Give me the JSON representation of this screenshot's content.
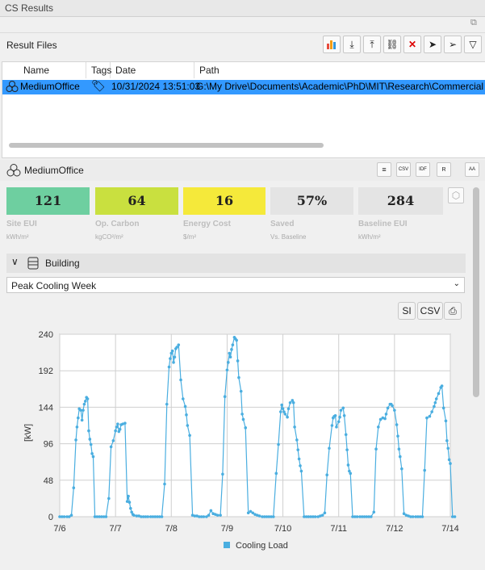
{
  "window": {
    "title": "CS Results"
  },
  "result_files": {
    "label": "Result Files"
  },
  "table": {
    "headers": [
      "Name",
      "Tags",
      "Date",
      "Path"
    ],
    "rows": [
      {
        "name": "MediumOffice",
        "date": "10/31/2024 13:51:03",
        "path": "G:\\My Drive\\Documents\\Academic\\PhD\\MIT\\Research\\Commercial"
      }
    ]
  },
  "detail": {
    "name": "MediumOffice"
  },
  "kpis": [
    {
      "value": "121",
      "label": "Site EUI",
      "unit": "kWh/m²",
      "color": "#6ecfa0"
    },
    {
      "value": "64",
      "label": "Op. Carbon",
      "unit": "kgCO²/m²",
      "color": "#c9e03f"
    },
    {
      "value": "16",
      "label": "Energy Cost",
      "unit": "$/m²",
      "color": "#f5e93a"
    },
    {
      "value": "57%",
      "label": "Saved",
      "unit": "Vs. Baseline",
      "color": "#e4e4e4"
    },
    {
      "value": "284",
      "label": "Baseline EUI",
      "unit": "kWh/m²",
      "color": "#e4e4e4"
    }
  ],
  "section": {
    "label": "Building"
  },
  "dropdown": {
    "selected": "Peak Cooling Week"
  },
  "buttons": {
    "si": "SI",
    "csv": "CSV"
  },
  "chart_data": {
    "type": "line",
    "ylabel": "[kW]",
    "ylim": [
      0,
      240
    ],
    "yticks": [
      "0",
      "48",
      "96",
      "144",
      "192",
      "240"
    ],
    "xticks": [
      "7/6",
      "7/7",
      "7/8",
      "7/9",
      "7/10",
      "7/11",
      "7/12",
      "7/14"
    ],
    "xlim": [
      0,
      7
    ],
    "color": "#4aaee0",
    "series": [
      {
        "name": "Cooling Load",
        "points": [
          [
            0.0,
            0
          ],
          [
            0.04,
            0
          ],
          [
            0.08,
            0
          ],
          [
            0.13,
            0
          ],
          [
            0.17,
            0
          ],
          [
            0.21,
            2
          ],
          [
            0.25,
            38
          ],
          [
            0.29,
            101
          ],
          [
            0.31,
            118
          ],
          [
            0.33,
            130
          ],
          [
            0.35,
            142
          ],
          [
            0.38,
            140
          ],
          [
            0.4,
            127
          ],
          [
            0.42,
            140
          ],
          [
            0.44,
            148
          ],
          [
            0.46,
            152
          ],
          [
            0.48,
            157
          ],
          [
            0.5,
            155
          ],
          [
            0.52,
            113
          ],
          [
            0.54,
            102
          ],
          [
            0.56,
            95
          ],
          [
            0.58,
            83
          ],
          [
            0.6,
            79
          ],
          [
            0.63,
            0
          ],
          [
            0.67,
            0
          ],
          [
            0.71,
            0
          ],
          [
            0.75,
            0
          ],
          [
            0.79,
            0
          ],
          [
            0.83,
            0
          ],
          [
            0.88,
            24
          ],
          [
            0.92,
            92
          ],
          [
            0.96,
            100
          ],
          [
            1.0,
            113
          ],
          [
            1.02,
            118
          ],
          [
            1.04,
            122
          ],
          [
            1.06,
            112
          ],
          [
            1.08,
            115
          ],
          [
            1.1,
            121
          ],
          [
            1.13,
            122
          ],
          [
            1.17,
            123
          ],
          [
            1.21,
            20
          ],
          [
            1.23,
            27
          ],
          [
            1.25,
            19
          ],
          [
            1.27,
            11
          ],
          [
            1.29,
            6
          ],
          [
            1.31,
            3
          ],
          [
            1.33,
            2
          ],
          [
            1.38,
            1
          ],
          [
            1.42,
            1
          ],
          [
            1.46,
            0
          ],
          [
            1.5,
            0
          ],
          [
            1.54,
            0
          ],
          [
            1.58,
            0
          ],
          [
            1.63,
            0
          ],
          [
            1.67,
            0
          ],
          [
            1.71,
            0
          ],
          [
            1.75,
            0
          ],
          [
            1.79,
            0
          ],
          [
            1.83,
            0
          ],
          [
            1.88,
            43
          ],
          [
            1.92,
            148
          ],
          [
            1.96,
            197
          ],
          [
            1.98,
            208
          ],
          [
            2.0,
            215
          ],
          [
            2.02,
            218
          ],
          [
            2.04,
            203
          ],
          [
            2.06,
            210
          ],
          [
            2.08,
            221
          ],
          [
            2.1,
            223
          ],
          [
            2.13,
            226
          ],
          [
            2.17,
            180
          ],
          [
            2.21,
            155
          ],
          [
            2.25,
            145
          ],
          [
            2.27,
            134
          ],
          [
            2.29,
            120
          ],
          [
            2.33,
            107
          ],
          [
            2.38,
            2
          ],
          [
            2.42,
            1
          ],
          [
            2.46,
            1
          ],
          [
            2.5,
            0
          ],
          [
            2.54,
            0
          ],
          [
            2.58,
            0
          ],
          [
            2.63,
            0
          ],
          [
            2.67,
            2
          ],
          [
            2.71,
            8
          ],
          [
            2.75,
            4
          ],
          [
            2.79,
            3
          ],
          [
            2.83,
            2
          ],
          [
            2.88,
            2
          ],
          [
            2.92,
            56
          ],
          [
            2.96,
            158
          ],
          [
            3.0,
            193
          ],
          [
            3.02,
            203
          ],
          [
            3.04,
            215
          ],
          [
            3.06,
            210
          ],
          [
            3.08,
            220
          ],
          [
            3.1,
            226
          ],
          [
            3.13,
            236
          ],
          [
            3.15,
            234
          ],
          [
            3.17,
            232
          ],
          [
            3.19,
            205
          ],
          [
            3.21,
            183
          ],
          [
            3.25,
            165
          ],
          [
            3.27,
            135
          ],
          [
            3.29,
            128
          ],
          [
            3.33,
            117
          ],
          [
            3.38,
            5
          ],
          [
            3.42,
            7
          ],
          [
            3.46,
            5
          ],
          [
            3.5,
            3
          ],
          [
            3.54,
            2
          ],
          [
            3.58,
            1
          ],
          [
            3.63,
            0
          ],
          [
            3.67,
            0
          ],
          [
            3.71,
            0
          ],
          [
            3.75,
            0
          ],
          [
            3.79,
            0
          ],
          [
            3.83,
            0
          ],
          [
            3.88,
            57
          ],
          [
            3.92,
            95
          ],
          [
            3.96,
            138
          ],
          [
            3.98,
            147
          ],
          [
            4.0,
            142
          ],
          [
            4.02,
            138
          ],
          [
            4.04,
            135
          ],
          [
            4.08,
            131
          ],
          [
            4.1,
            142
          ],
          [
            4.13,
            150
          ],
          [
            4.17,
            153
          ],
          [
            4.19,
            150
          ],
          [
            4.21,
            118
          ],
          [
            4.25,
            101
          ],
          [
            4.27,
            88
          ],
          [
            4.29,
            76
          ],
          [
            4.31,
            67
          ],
          [
            4.33,
            60
          ],
          [
            4.38,
            0
          ],
          [
            4.42,
            0
          ],
          [
            4.46,
            0
          ],
          [
            4.5,
            0
          ],
          [
            4.54,
            0
          ],
          [
            4.58,
            0
          ],
          [
            4.63,
            0
          ],
          [
            4.67,
            1
          ],
          [
            4.71,
            2
          ],
          [
            4.75,
            5
          ],
          [
            4.79,
            55
          ],
          [
            4.83,
            90
          ],
          [
            4.88,
            120
          ],
          [
            4.9,
            130
          ],
          [
            4.92,
            132
          ],
          [
            4.94,
            133
          ],
          [
            4.96,
            118
          ],
          [
            5.0,
            125
          ],
          [
            5.02,
            131
          ],
          [
            5.04,
            140
          ],
          [
            5.08,
            143
          ],
          [
            5.1,
            133
          ],
          [
            5.13,
            108
          ],
          [
            5.15,
            88
          ],
          [
            5.17,
            68
          ],
          [
            5.19,
            60
          ],
          [
            5.21,
            57
          ],
          [
            5.25,
            0
          ],
          [
            5.29,
            0
          ],
          [
            5.33,
            0
          ],
          [
            5.38,
            0
          ],
          [
            5.42,
            0
          ],
          [
            5.46,
            0
          ],
          [
            5.5,
            0
          ],
          [
            5.54,
            0
          ],
          [
            5.58,
            0
          ],
          [
            5.63,
            6
          ],
          [
            5.67,
            89
          ],
          [
            5.71,
            118
          ],
          [
            5.75,
            128
          ],
          [
            5.79,
            130
          ],
          [
            5.83,
            129
          ],
          [
            5.85,
            135
          ],
          [
            5.88,
            143
          ],
          [
            5.92,
            148
          ],
          [
            5.94,
            148
          ],
          [
            5.96,
            146
          ],
          [
            6.0,
            140
          ],
          [
            6.04,
            121
          ],
          [
            6.06,
            106
          ],
          [
            6.08,
            89
          ],
          [
            6.1,
            79
          ],
          [
            6.13,
            63
          ],
          [
            6.17,
            4
          ],
          [
            6.21,
            2
          ],
          [
            6.25,
            1
          ],
          [
            6.29,
            0
          ],
          [
            6.33,
            0
          ],
          [
            6.38,
            0
          ],
          [
            6.42,
            0
          ],
          [
            6.46,
            0
          ],
          [
            6.5,
            0
          ],
          [
            6.54,
            61
          ],
          [
            6.58,
            130
          ],
          [
            6.63,
            132
          ],
          [
            6.67,
            138
          ],
          [
            6.71,
            145
          ],
          [
            6.73,
            150
          ],
          [
            6.75,
            155
          ],
          [
            6.79,
            162
          ],
          [
            6.83,
            170
          ],
          [
            6.85,
            172
          ],
          [
            6.88,
            143
          ],
          [
            6.92,
            126
          ],
          [
            6.94,
            100
          ],
          [
            6.96,
            90
          ],
          [
            6.98,
            75
          ],
          [
            7.0,
            70
          ],
          [
            7.04,
            0
          ],
          [
            7.08,
            0
          ]
        ]
      }
    ]
  }
}
